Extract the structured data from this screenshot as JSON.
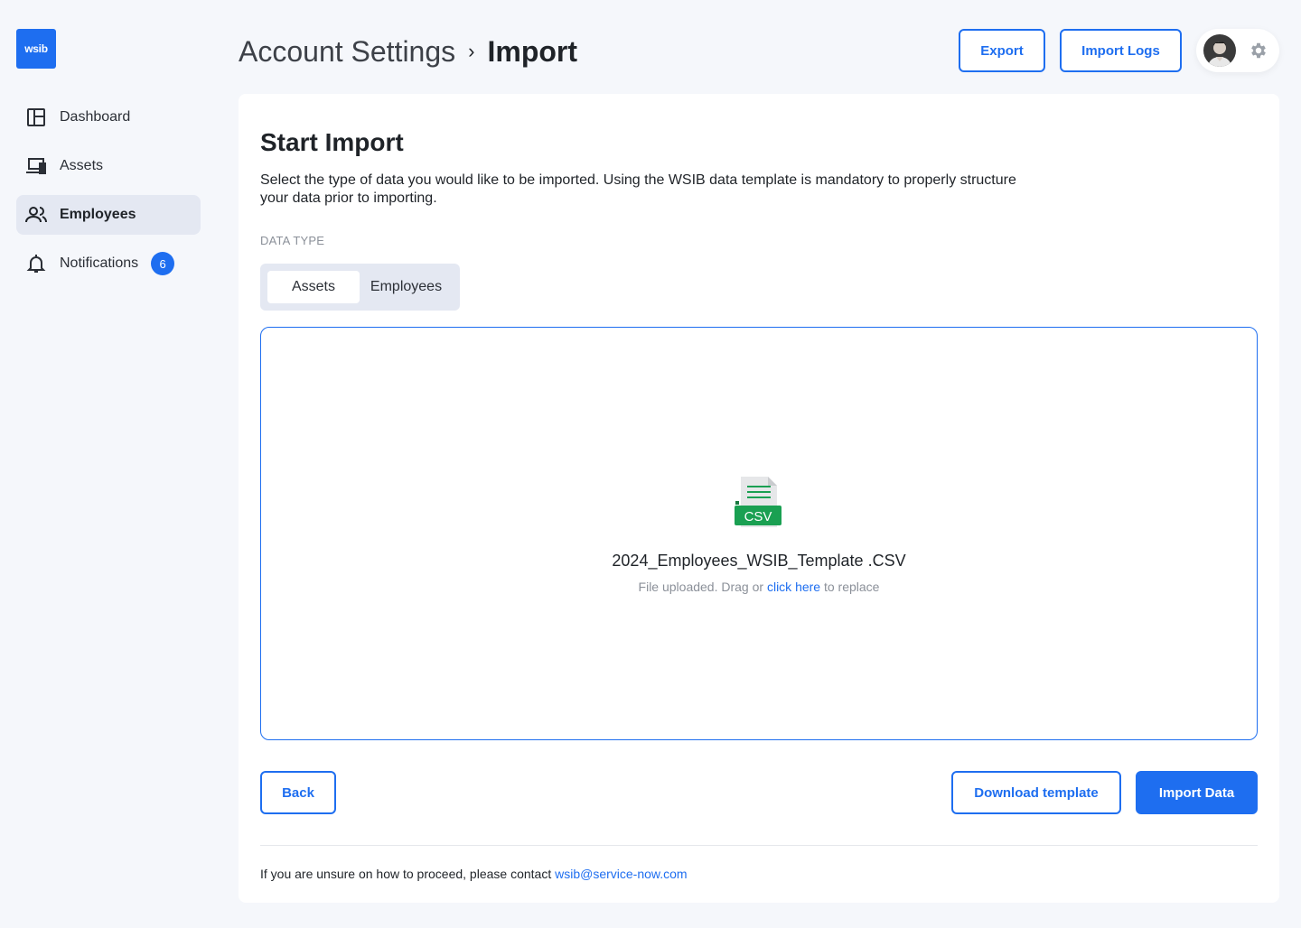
{
  "app": {
    "logo_text": "wsib"
  },
  "sidebar": {
    "items": [
      {
        "label": "Dashboard",
        "icon": "dashboard-icon"
      },
      {
        "label": "Assets",
        "icon": "devices-icon"
      },
      {
        "label": "Employees",
        "icon": "users-icon",
        "active": true
      },
      {
        "label": "Notifications",
        "icon": "bell-icon",
        "badge": "6"
      }
    ]
  },
  "header": {
    "breadcrumb_parent": "Account Settings",
    "breadcrumb_separator": "›",
    "breadcrumb_current": "Import",
    "export_label": "Export",
    "import_logs_label": "Import Logs"
  },
  "card": {
    "title": "Start Import",
    "description": "Select the type of data you would like to be imported. Using the WSIB data template is mandatory to properly structure your data prior to importing.",
    "data_type_label": "DATA TYPE",
    "data_types": [
      "Assets",
      "Employees"
    ],
    "selected_data_type": "Assets",
    "file": {
      "icon_label": "CSV",
      "name": "2024_Employees_WSIB_Template .CSV",
      "status_prefix": "File uploaded. Drag or",
      "status_link": "click here",
      "status_suffix": "to replace"
    },
    "back_label": "Back",
    "download_label": "Download template",
    "import_label": "Import Data",
    "footer_prefix": "If you are unsure on how to proceed, please contact",
    "footer_email": "wsib@service-now.com"
  },
  "colors": {
    "accent": "#1e6ef0",
    "csv_green": "#1aa052",
    "background": "#f5f7fb"
  }
}
